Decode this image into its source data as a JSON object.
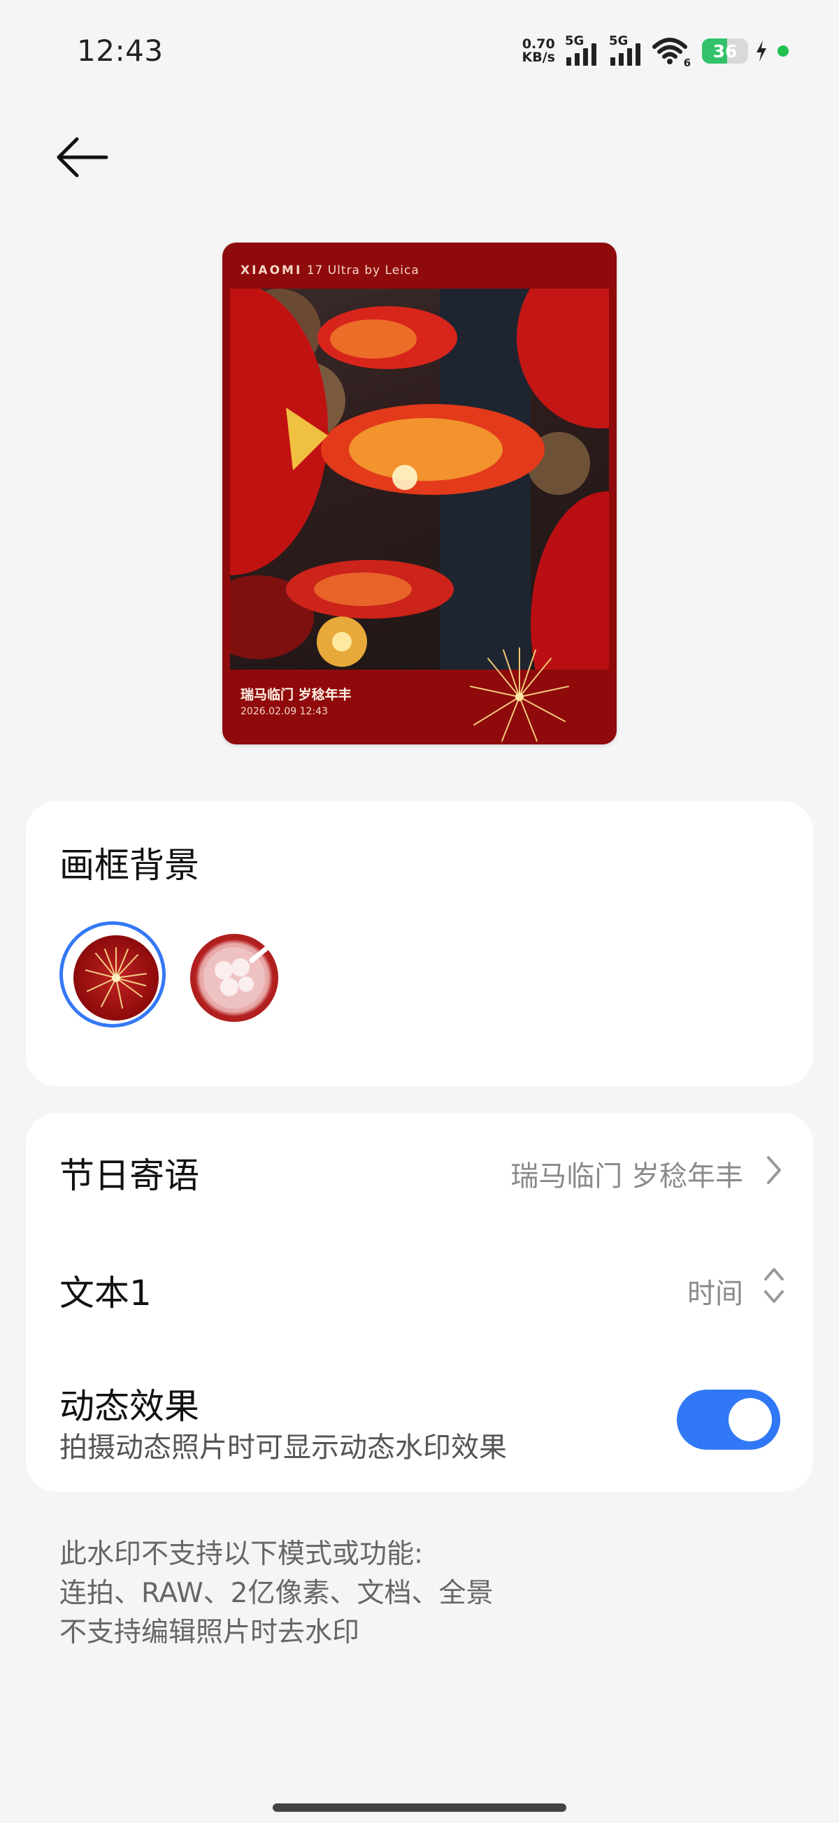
{
  "status_bar": {
    "time": "12:43",
    "net_speed_value": "0.70",
    "net_speed_unit": "KB/s",
    "sim1_tag": "5G",
    "sim2_tag": "5G",
    "wifi_tag": "6",
    "battery_level": "36",
    "accent_charging": "#33c26a"
  },
  "preview": {
    "brand_name": "XIAOMI",
    "brand_model": "17 Ultra by Leica",
    "slogan": "瑞马临门 岁稔年丰",
    "datetime": "2026.02.09 12:43"
  },
  "frame_background": {
    "title": "画框背景",
    "options": [
      {
        "name": "fireworks",
        "selected": true
      },
      {
        "name": "tangyuan",
        "selected": false
      }
    ],
    "selected_color": "#3478f6"
  },
  "settings": {
    "greeting_label": "节日寄语",
    "greeting_value": "瑞马临门 岁稔年丰",
    "text1_label": "文本1",
    "text1_value": "时间",
    "dynamic_label": "动态效果",
    "dynamic_desc": "拍摄动态照片时可显示动态水印效果",
    "dynamic_enabled": true,
    "toggle_color": "#3078f5"
  },
  "note": {
    "line1": "此水印不支持以下模式或功能:",
    "line2": "连拍、RAW、2亿像素、文档、全景",
    "line3": "不支持编辑照片时去水印"
  }
}
